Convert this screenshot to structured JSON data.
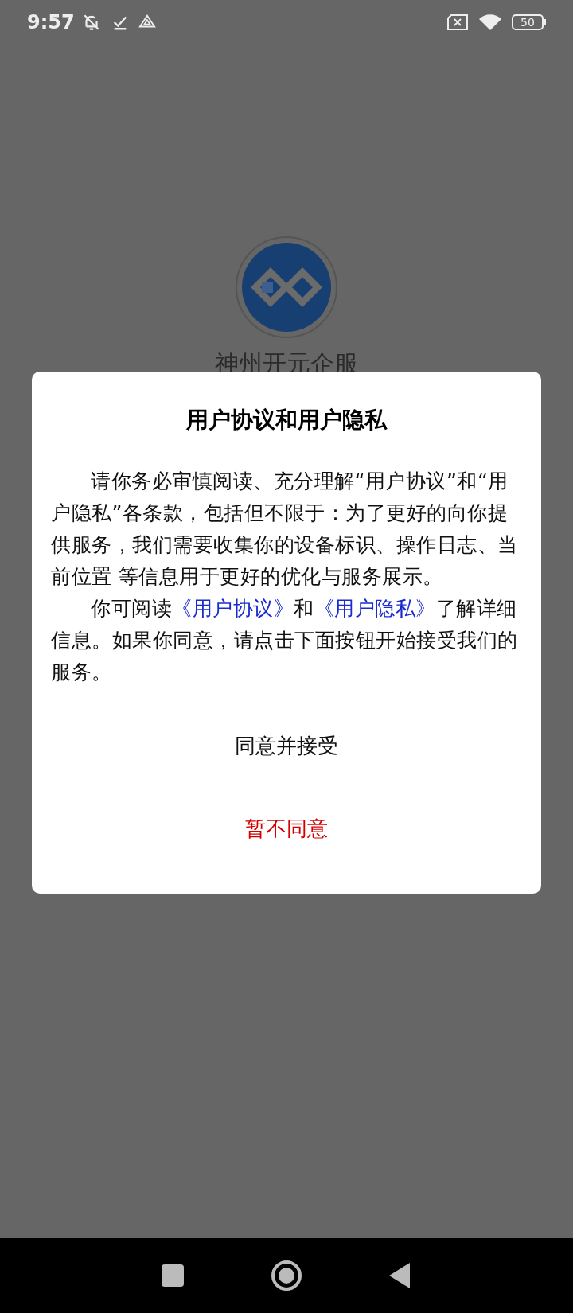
{
  "status_bar": {
    "time": "9:57",
    "battery": "50"
  },
  "app": {
    "name": "神州开元企服"
  },
  "dialog": {
    "title": "用户协议和用户隐私",
    "paragraphs": [
      [
        {
          "kind": "text",
          "text": "请你务必审慎阅读、充分理解“用户协议”和“用户隐私”各条款，包括但不限于：为了更好的向你提供服务，我们需要收集你的设备标识、操作日志、当前位置 等信息用于更好的优化与服务展示。"
        }
      ],
      [
        {
          "kind": "text",
          "text": "你可阅读"
        },
        {
          "kind": "link",
          "text": "《用户协议》"
        },
        {
          "kind": "text",
          "text": "和"
        },
        {
          "kind": "link",
          "text": "《用户隐私》"
        },
        {
          "kind": "text",
          "text": "了解详细信息。如果你同意，请点击下面按钮开始接受我们的服务。"
        }
      ]
    ],
    "buttons": [
      {
        "kind": "accept",
        "label": "同意并接受"
      },
      {
        "kind": "decline",
        "label": "暂不同意"
      }
    ]
  }
}
